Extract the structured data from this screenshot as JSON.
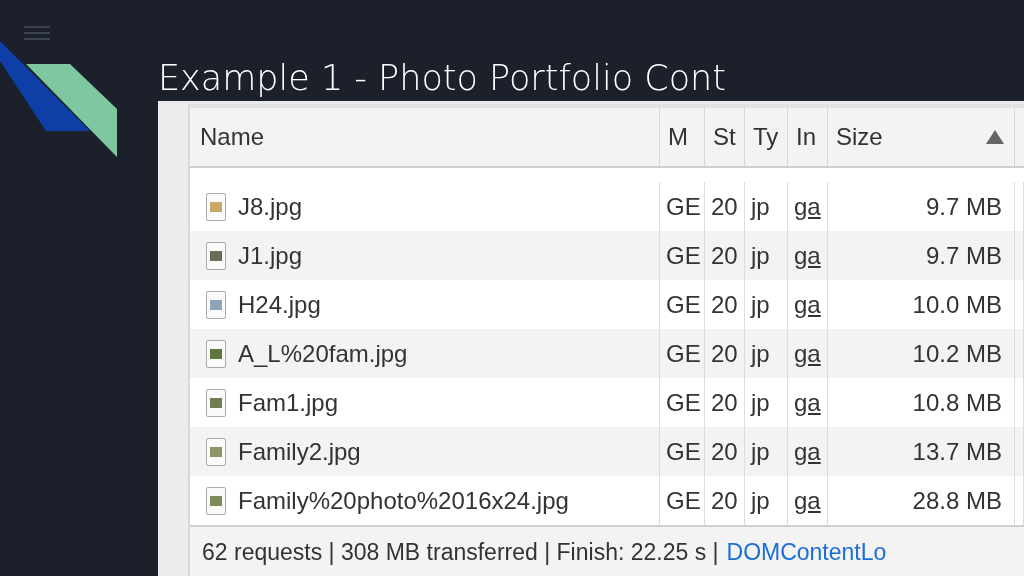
{
  "slide": {
    "title": "Example 1 - Photo Portfolio Cont"
  },
  "table": {
    "columns": [
      {
        "label": "Name",
        "sorted": false
      },
      {
        "label": "M",
        "sorted": false
      },
      {
        "label": "St",
        "sorted": false
      },
      {
        "label": "Ty",
        "sorted": false
      },
      {
        "label": "In",
        "sorted": false
      },
      {
        "label": "Size",
        "sorted": true
      }
    ],
    "rows": [
      {
        "cells": [
          "J8.jpg",
          "GE",
          "20",
          "jp",
          "ga",
          "9.7 MB"
        ]
      },
      {
        "cells": [
          "J1.jpg",
          "GE",
          "20",
          "jp",
          "ga",
          "9.7 MB"
        ]
      },
      {
        "cells": [
          "H24.jpg",
          "GE",
          "20",
          "jp",
          "ga",
          "10.0 MB"
        ]
      },
      {
        "cells": [
          "A_L%20fam.jpg",
          "GE",
          "20",
          "jp",
          "ga",
          "10.2 MB"
        ]
      },
      {
        "cells": [
          "Fam1.jpg",
          "GE",
          "20",
          "jp",
          "ga",
          "10.8 MB"
        ]
      },
      {
        "cells": [
          "Family2.jpg",
          "GE",
          "20",
          "jp",
          "ga",
          "13.7 MB"
        ]
      },
      {
        "cells": [
          "Family%20photo%2016x24.jpg",
          "GE",
          "20",
          "jp",
          "ga",
          "28.8 MB"
        ]
      }
    ]
  },
  "status_bar": {
    "summary": "62 requests | 308 MB transferred | Finish: 22.25 s |",
    "link": "DOMContentLo"
  }
}
